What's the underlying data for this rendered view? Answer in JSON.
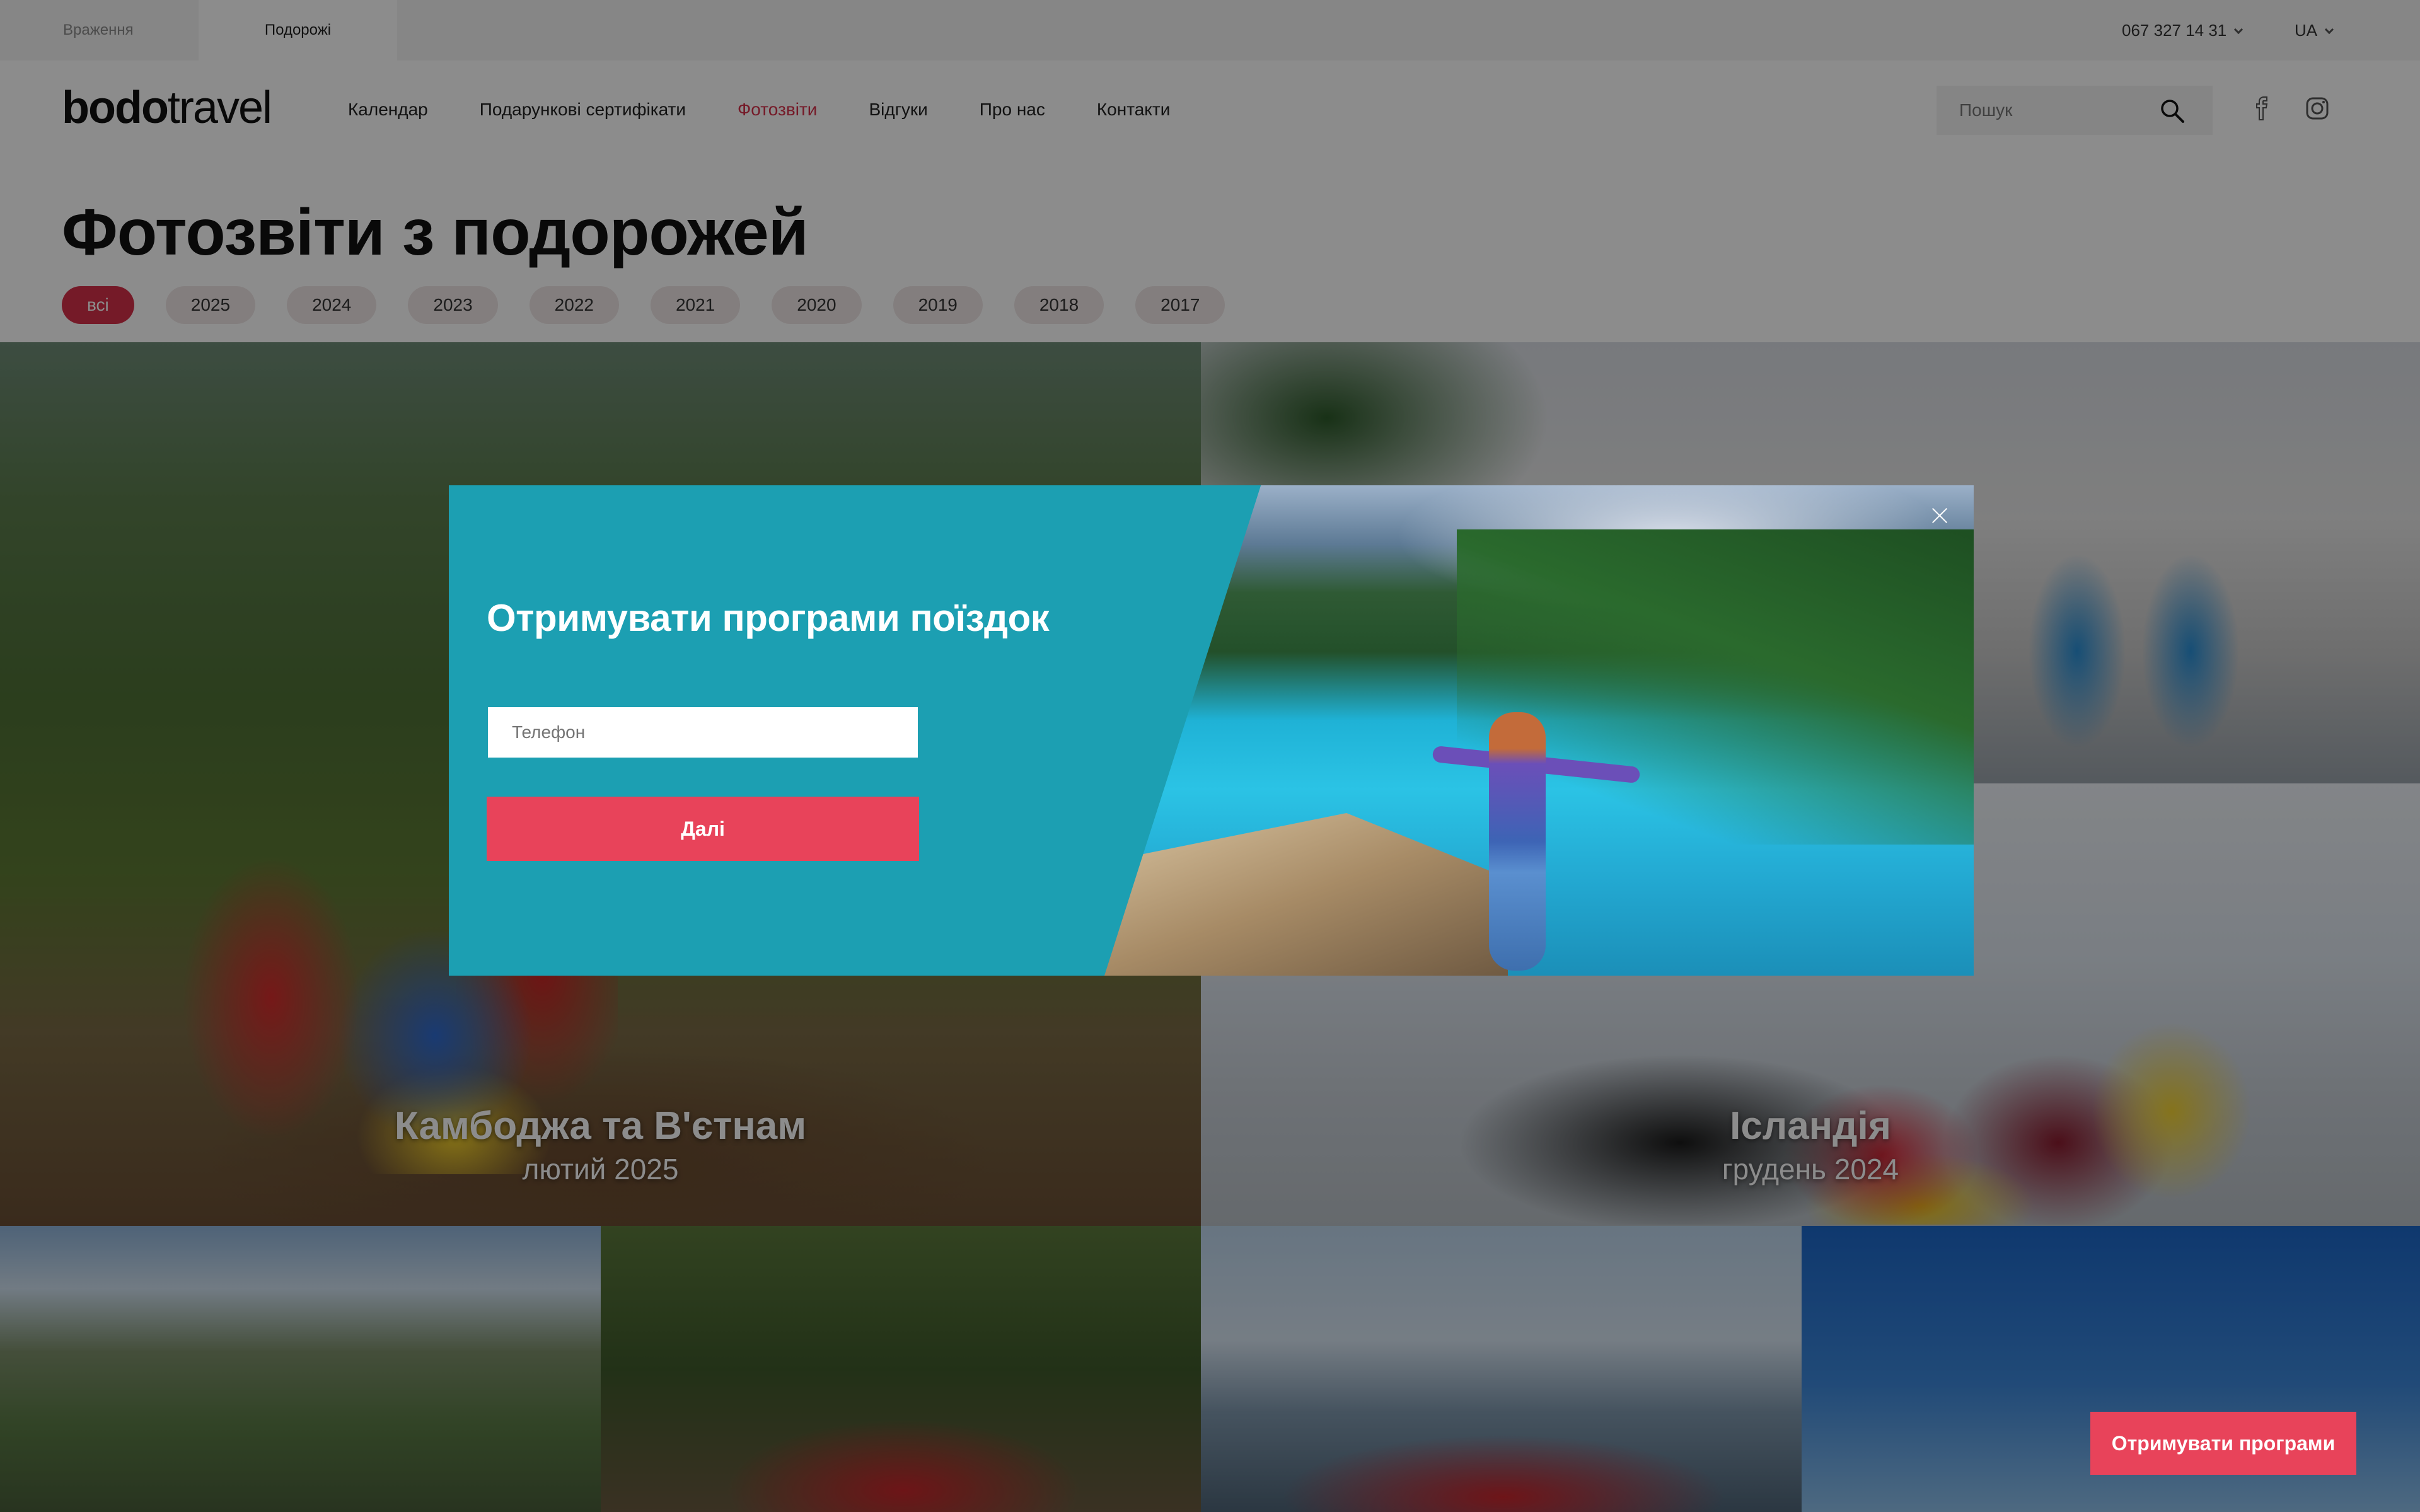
{
  "topbar": {
    "tabs": [
      "Враження",
      "Подорожі"
    ],
    "phone": "067 327 14 31",
    "lang": "UA"
  },
  "header": {
    "logo_bold": "bodo",
    "logo_light": "travel",
    "nav": [
      "Календар",
      "Подарункові сертифікати",
      "Фотозвіти",
      "Відгуки",
      "Про нас",
      "Контакти"
    ],
    "active_nav": "Фотозвіти",
    "search_placeholder": "Пошук"
  },
  "page": {
    "title": "Фотозвіти з подорожей",
    "filters": [
      "всі",
      "2025",
      "2024",
      "2023",
      "2022",
      "2021",
      "2020",
      "2019",
      "2018",
      "2017"
    ],
    "active_filter": "всі"
  },
  "tiles": [
    {
      "name": "Камбоджа та В'єтнам",
      "date": "лютий 2025"
    },
    {
      "name": "Ісландія",
      "date": "грудень 2024"
    }
  ],
  "cta_label": "Отримувати програми",
  "modal": {
    "title": "Отримувати програми поїздок",
    "phone_placeholder": "Телефон",
    "submit_label": "Далі"
  },
  "colors": {
    "accent": "#e8435a",
    "active_red": "#d6304a",
    "modal_bg": "#1c9fb2"
  }
}
